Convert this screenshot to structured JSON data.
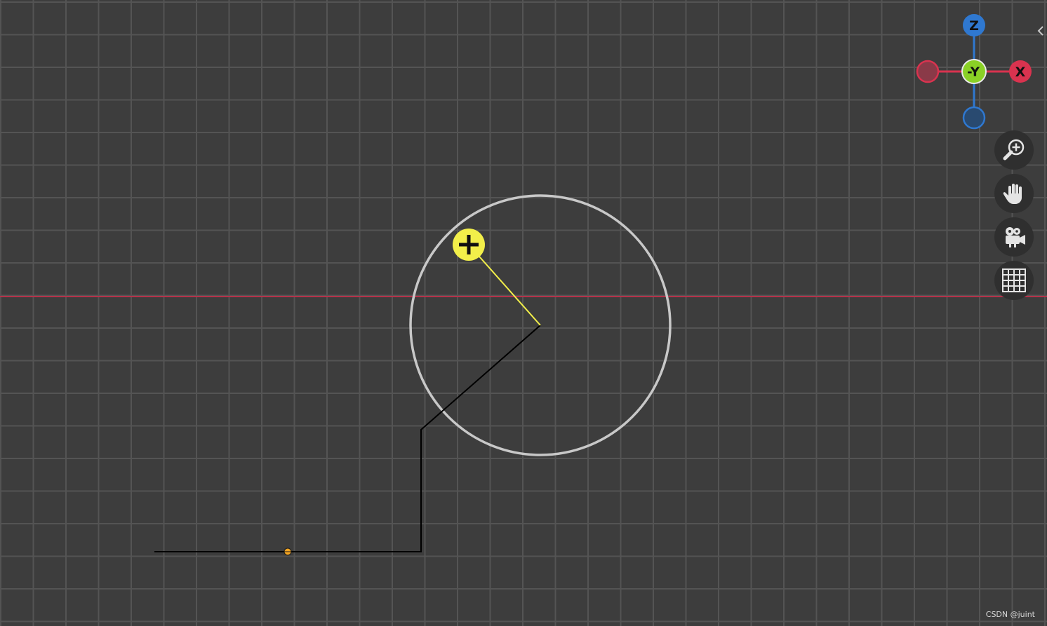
{
  "viewport": {
    "view_axis_label": "-Y",
    "colors": {
      "background": "#3d3d3d",
      "grid_line": "#545454",
      "x_axis_line": "#b5324a",
      "circle": "#c8c8c8",
      "curve": "#000000",
      "handle_line": "#f2ef4a",
      "origin_point": "#f5a623"
    }
  },
  "gizmo": {
    "z_label": "Z",
    "y_label": "-Y",
    "x_label": "X",
    "colors": {
      "z": "#2f78d0",
      "y": "#8ad126",
      "x": "#d9334f"
    }
  },
  "object_handle": {
    "icon": "plus-icon",
    "color": "#f2ef4a"
  },
  "nav_tools": [
    {
      "name": "zoom",
      "icon": "zoom-in-icon"
    },
    {
      "name": "pan",
      "icon": "hand-icon"
    },
    {
      "name": "camera",
      "icon": "camera-icon"
    },
    {
      "name": "grid",
      "icon": "grid-icon"
    }
  ],
  "sidebar_toggle": {
    "icon": "chevron-left-icon"
  },
  "watermark": "CSDN @juint"
}
